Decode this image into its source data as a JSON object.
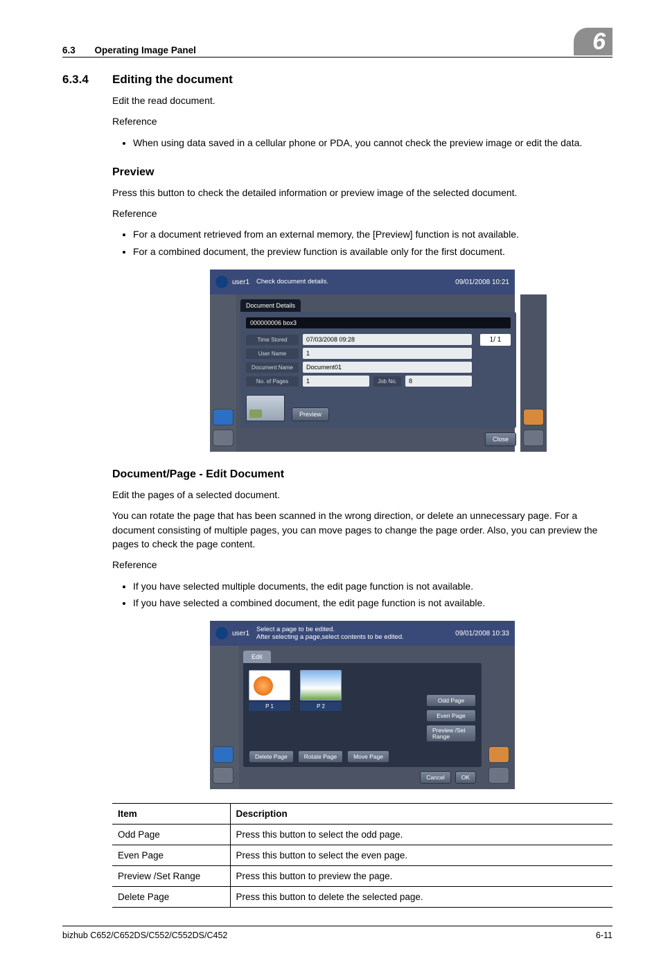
{
  "header": {
    "section_number": "6.3",
    "section_title": "Operating Image Panel",
    "chapter_num": "6"
  },
  "s1": {
    "num": "6.3.4",
    "title": "Editing the document",
    "intro": "Edit the read document.",
    "ref_label": "Reference",
    "bullet1": "When using data saved in a cellular phone or PDA, you cannot check the preview image or edit the data."
  },
  "preview": {
    "heading": "Preview",
    "intro": "Press this button to check the detailed information or preview image of the selected document.",
    "ref_label": "Reference",
    "b1": "For a document retrieved from an external memory, the [Preview] function is not available.",
    "b2": "For a combined document, the preview function is available only for the first document."
  },
  "ss1": {
    "user": "user1",
    "msg": "Check document details.",
    "date": "09/01/2008  10:21",
    "tab": "Document Details",
    "filebar": "000000006 box3",
    "time_lbl": "Time Stored",
    "time_val": "07/03/2008 09:28",
    "user_lbl": "User Name",
    "user_val": "1",
    "doc_lbl": "Document Name",
    "doc_val": "Document01",
    "pages_lbl": "No. of Pages",
    "pages_val": "1",
    "job_lbl": "Job No.",
    "job_val": "8",
    "page_ind": "1/  1",
    "preview_btn": "Preview",
    "close_btn": "Close"
  },
  "editdoc": {
    "heading": "Document/Page - Edit Document",
    "intro": "Edit the pages of a selected document.",
    "para": "You can rotate the page that has been scanned in the wrong direction, or delete an unnecessary page. For a document consisting of multiple pages, you can move pages to change the page order. Also, you can preview the pages to check the page content.",
    "ref_label": "Reference",
    "b1": "If you have selected multiple documents, the edit page function is not available.",
    "b2": "If you have selected a combined document, the edit page function is not available."
  },
  "ss2": {
    "user": "user1",
    "msg1": "Select a page to be edited.",
    "msg2": "After selecting a page,select contents to be edited.",
    "date": "09/01/2008  10:33",
    "tab": "Edit",
    "t1": "P    1",
    "t2": "P    2",
    "odd": "Odd Page",
    "even": "Even Page",
    "prev": "Preview /Set Range",
    "del": "Delete Page",
    "rot": "Rotate Page",
    "mov": "Move Page",
    "cancel": "Cancel",
    "ok": "OK"
  },
  "table": {
    "h_item": "Item",
    "h_desc": "Description",
    "r1i": "Odd Page",
    "r1d": "Press this button to select the odd page.",
    "r2i": "Even Page",
    "r2d": "Press this button to select the even page.",
    "r3i": "Preview /Set Range",
    "r3d": "Press this button to preview the page.",
    "r4i": "Delete Page",
    "r4d": "Press this button to delete the selected page."
  },
  "footer": {
    "model": "bizhub C652/C652DS/C552/C552DS/C452",
    "page": "6-11"
  }
}
